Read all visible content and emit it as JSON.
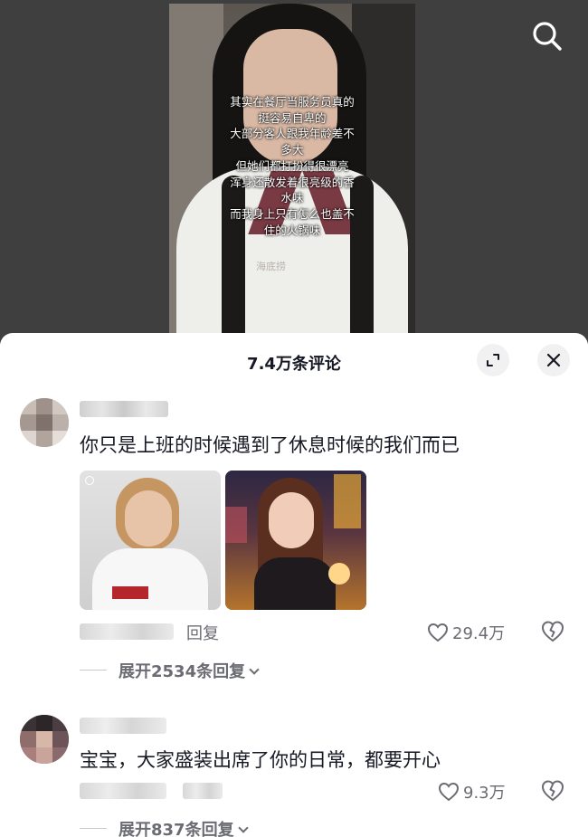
{
  "video": {
    "caption_lines": [
      "其实在餐厅当服务员真的",
      "挺容易自卑的",
      "大部分客人跟我年龄差不",
      "多大",
      "但她们都打扮得很漂亮",
      "浑身还散发着很亮级的香",
      "水味",
      "而我身上只有怎么也盖不",
      "住的火锅味"
    ],
    "badge_text": "海底捞",
    "search_icon": "search-icon"
  },
  "comments_panel": {
    "title": "7.4万条评论",
    "expand_icon": "expand-icon",
    "close_icon": "close-icon"
  },
  "comments": [
    {
      "text": "你只是上班的时候遇到了休息时候的我们而已",
      "reply_label": "回复",
      "likes": "29.4万",
      "expand_replies": "展开2534条回复"
    },
    {
      "text": "宝宝，大家盛装出席了你的日常，都要开心",
      "likes": "9.3万",
      "expand_replies": "展开837条回复"
    }
  ],
  "colors": {
    "text_primary": "#161823",
    "text_secondary": "#6b6b73",
    "panel_bg": "#ffffff",
    "video_bg": "#3f3f3f"
  }
}
